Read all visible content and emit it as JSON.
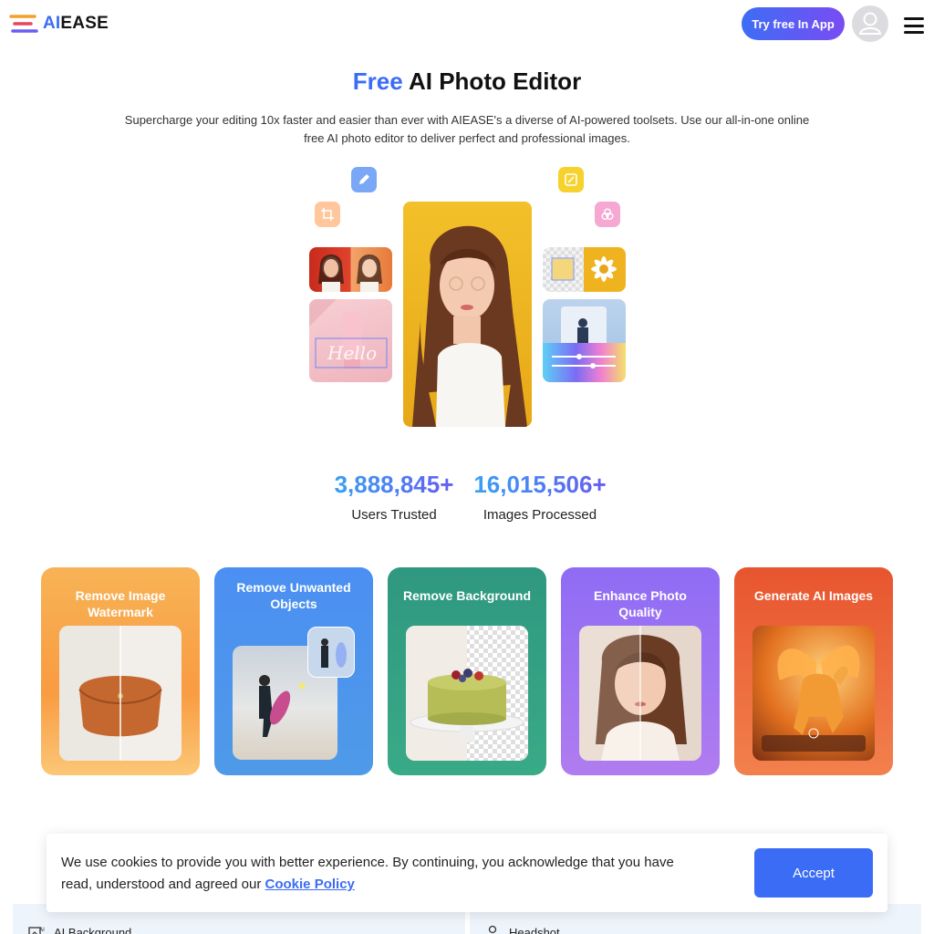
{
  "header": {
    "logo_ai": "AI",
    "logo_ease": "EASE",
    "try_button": "Try free In App"
  },
  "hero": {
    "title_free": "Free",
    "title_rest": "AI Photo Editor",
    "subtitle": "Supercharge your editing 10x faster and easier than ever with AIEASE's a diverse of AI-powered toolsets. Use our all-in-one online free AI photo editor to deliver perfect and professional images.",
    "tool_icons": [
      "pencil-icon",
      "crop-icon",
      "enhance-icon",
      "filter-icon"
    ]
  },
  "stats": [
    {
      "value": "3,888,845+",
      "label": "Users Trusted"
    },
    {
      "value": "16,015,506+",
      "label": "Images Processed"
    }
  ],
  "features": [
    {
      "title": "Remove Image Watermark",
      "color": "#f6a04b"
    },
    {
      "title": "Remove Unwanted Objects",
      "color": "#4a8ff0"
    },
    {
      "title": "Remove Background",
      "color": "#2f9e84"
    },
    {
      "title": "Enhance Photo Quality",
      "color": "#9a74f2"
    },
    {
      "title": "Generate AI Images",
      "color": "#f0683a"
    }
  ],
  "cookie": {
    "text": "We use cookies to provide you with better experience. By continuing, you acknowledge that you have read, understood and agreed our",
    "link": "Cookie Policy",
    "accept": "Accept"
  },
  "bottom": {
    "left_label": "AI Background",
    "right_label": "Headshot"
  }
}
